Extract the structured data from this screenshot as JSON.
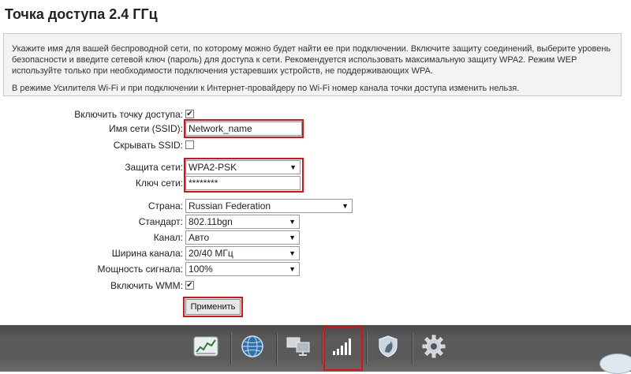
{
  "title": "Точка доступа 2.4 ГГц",
  "info": {
    "paragraph1": "Укажите имя для вашей беспроводной сети, по которому можно будет найти ее при подключении. Включите защиту соединений, выберите уровень безопасности и введите сетевой ключ (пароль) для доступа к сети. Рекомендуется использовать максимальную защиту WPA2. Режим WEP используйте только при необходимости подключения устаревших устройств, не поддерживающих WPA.",
    "paragraph2": "В режиме Усилителя Wi-Fi и при подключении к Интернет-провайдеру по Wi-Fi номер канала точки доступа изменить нельзя."
  },
  "form": {
    "enable_ap": {
      "label": "Включить точку доступа:",
      "checked": true
    },
    "ssid": {
      "label": "Имя сети (SSID):",
      "value": "Network_name"
    },
    "hide_ssid": {
      "label": "Скрывать SSID:",
      "checked": false
    },
    "security": {
      "label": "Защита сети:",
      "value": "WPA2-PSK"
    },
    "key": {
      "label": "Ключ сети:",
      "value": "********"
    },
    "country": {
      "label": "Страна:",
      "value": "Russian Federation"
    },
    "standard": {
      "label": "Стандарт:",
      "value": "802.11bgn"
    },
    "channel": {
      "label": "Канал:",
      "value": "Авто"
    },
    "bandwidth": {
      "label": "Ширина канала:",
      "value": "20/40 МГц"
    },
    "power": {
      "label": "Мощность сигнала:",
      "value": "100%"
    },
    "wmm": {
      "label": "Включить WMM:",
      "checked": true
    },
    "apply_label": "Применить"
  },
  "check_glyph": "✔",
  "select_arrow": "▼",
  "nav": {
    "items": [
      {
        "icon": "chart-icon"
      },
      {
        "icon": "globe-icon"
      },
      {
        "icon": "network-computers-icon"
      },
      {
        "icon": "wifi-signal-bars-icon",
        "active": true
      },
      {
        "icon": "shield-icon"
      },
      {
        "icon": "gear-icon"
      }
    ]
  },
  "colors": {
    "highlight": "#e01010",
    "bottom_bar": "#555555",
    "signal_bars": "#ffffff"
  }
}
